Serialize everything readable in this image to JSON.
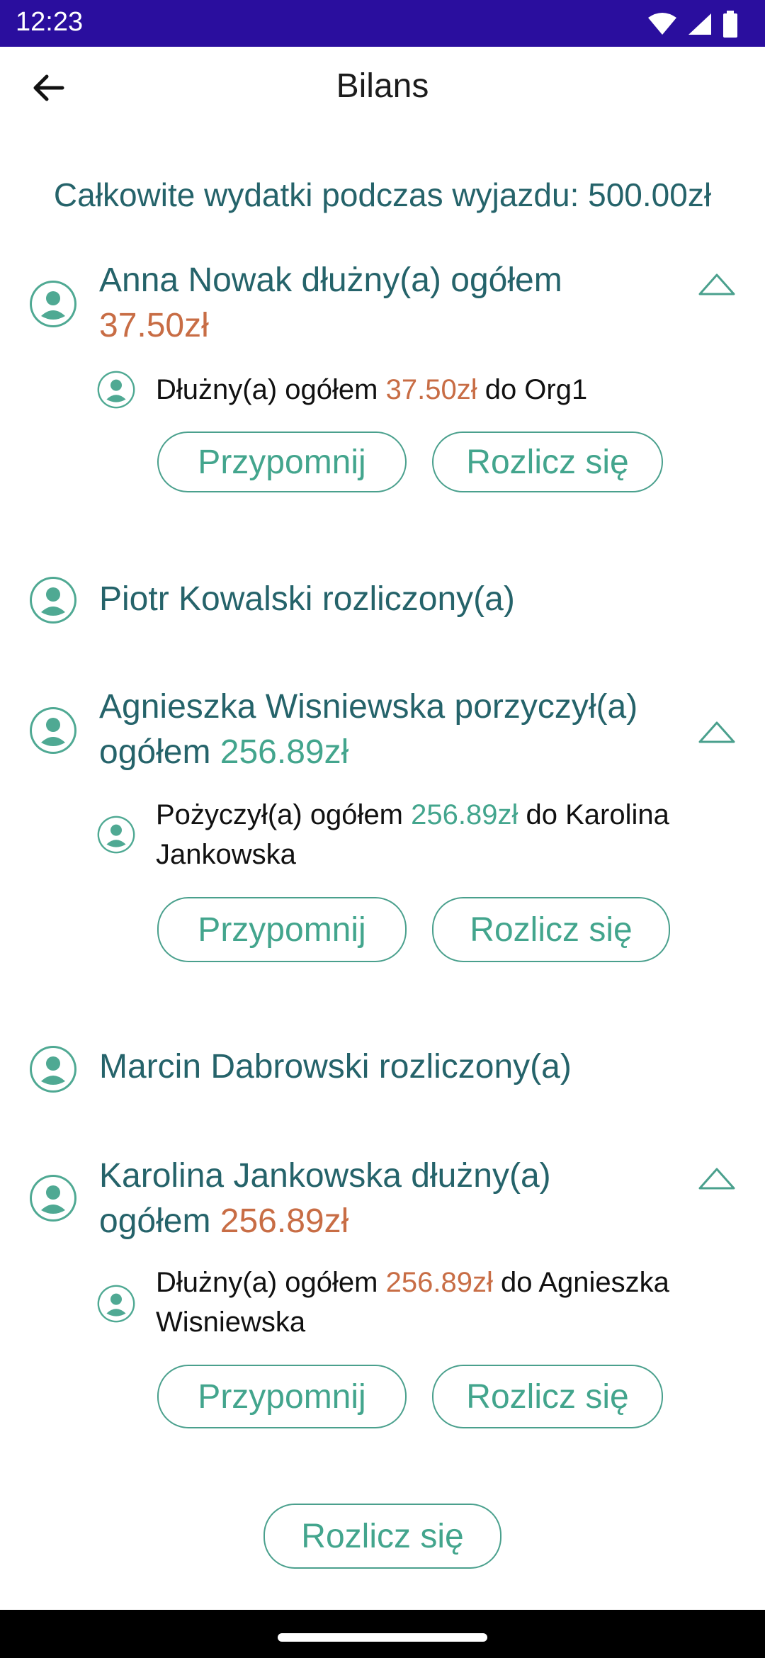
{
  "status": {
    "time": "12:23"
  },
  "header": {
    "title": "Bilans"
  },
  "summary": {
    "text": "Całkowite wydatki podczas wyjazdu: 500.00zł"
  },
  "people": [
    {
      "name_text": "Anna Nowak dłużny(a) ogółem",
      "amount": "37.50zł",
      "detail": {
        "prefix": "Dłużny(a) ogółem",
        "amount": "37.50zł",
        "suffix": "do Org1"
      },
      "actions": {
        "remind": "Przypomnij",
        "settle": "Rozlicz się"
      }
    },
    {
      "name_text": "Piotr Kowalski rozliczony(a)"
    },
    {
      "name_text_line1": "Agnieszka Wisniewska porzyczył(a)",
      "name_text_line2": "ogółem",
      "amount": "256.89zł",
      "detail": {
        "prefix": "Pożyczył(a) ogółem",
        "amount": "256.89zł",
        "suffix": "do Karolina",
        "suffix2": "Jankowska"
      },
      "actions": {
        "remind": "Przypomnij",
        "settle": "Rozlicz się"
      }
    },
    {
      "name_text": "Marcin Dabrowski rozliczony(a)"
    },
    {
      "name_text_line1": "Karolina Jankowska dłużny(a)",
      "name_text_line2": "ogółem",
      "amount": "256.89zł",
      "detail": {
        "prefix": "Dłużny(a) ogółem",
        "amount": "256.89zł",
        "suffix": "do Agnieszka",
        "suffix2": "Wisniewska"
      },
      "actions": {
        "remind": "Przypomnij",
        "settle": "Rozlicz się"
      }
    }
  ],
  "footer": {
    "settle_all": "Rozlicz się"
  },
  "colors": {
    "teal_text": "#25636a",
    "accent": "#43a58d",
    "debt": "#c86d45",
    "statusbar": "#2a0e9e"
  }
}
